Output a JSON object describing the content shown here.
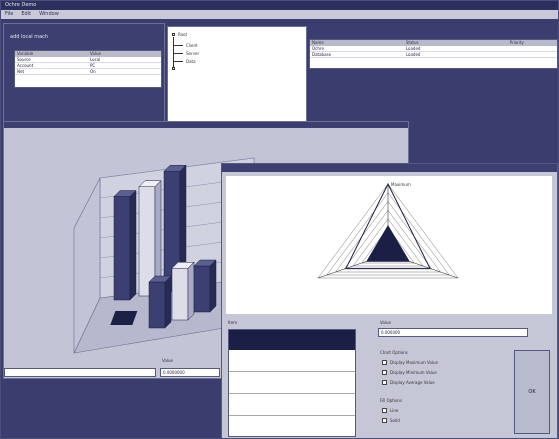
{
  "app": {
    "title": "Ochre Demo"
  },
  "menu": [
    "File",
    "Edit",
    "Window"
  ],
  "query_panel": {
    "heading": "add local mach",
    "table": {
      "columns": [
        "Variable",
        "Value"
      ],
      "rows": [
        [
          "Source",
          "Local"
        ],
        [
          "Account",
          "PC"
        ],
        [
          "Net",
          "On"
        ]
      ]
    }
  },
  "tree": {
    "root": "Root",
    "children": [
      "Client",
      "Server",
      "Data"
    ]
  },
  "right_table": {
    "columns": [
      "Name",
      "Status",
      "Priority"
    ],
    "rows": [
      [
        "Ochre",
        "Loaded"
      ],
      [
        "Database",
        "Loaded"
      ]
    ]
  },
  "chart_window": {
    "input_label": "Value",
    "input_value": "0.0000000"
  },
  "radar_window": {
    "peak_label": "Maximum",
    "left_label": "Item",
    "right_label": "Value",
    "right_input": "0.000000",
    "options_heading": "Chart Options",
    "options": [
      "Display Maximum Value",
      "Display Minimum Value",
      "Display Average Value"
    ],
    "fill_heading": "Fill Options",
    "fill_options": [
      "Line",
      "Solid"
    ],
    "go_button": "OK"
  },
  "colors": {
    "navy": "#2d305e",
    "panel": "#c8c9d8",
    "bar_dark": "#3b3f72",
    "bar_light": "#dcdde8"
  },
  "chart_data": [
    {
      "type": "bar",
      "title": "",
      "xlabel": "",
      "ylabel": "",
      "categories": [
        "",
        "",
        "",
        "",
        "",
        ""
      ],
      "series": [
        {
          "values": [
            90,
            95,
            105,
            40,
            45,
            40
          ]
        }
      ],
      "grid": true,
      "three_d": true
    },
    {
      "type": "radar",
      "title": "",
      "series": [
        {
          "values": [
            100,
            60,
            60
          ]
        },
        {
          "values": [
            40,
            30,
            30
          ]
        }
      ],
      "rings": 8,
      "grid": true
    }
  ]
}
